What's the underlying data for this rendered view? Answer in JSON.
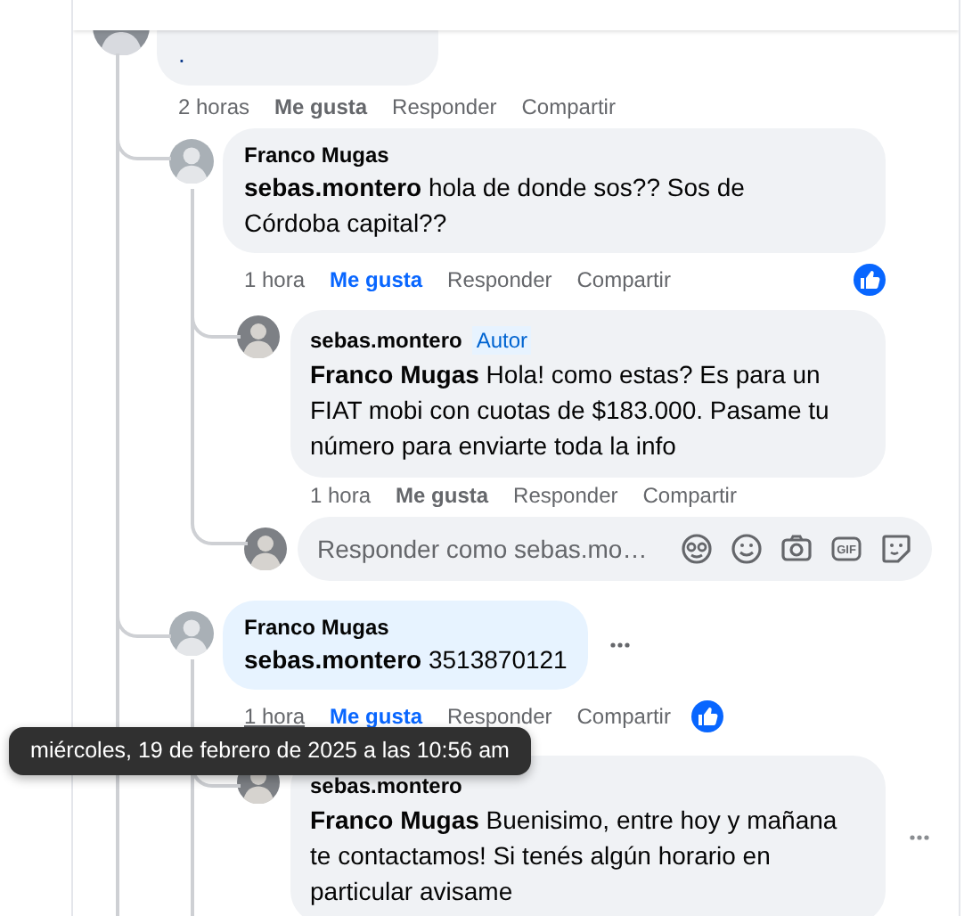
{
  "comment": {
    "body": ".",
    "time": "2 horas",
    "like": "Me gusta",
    "reply": "Responder",
    "share": "Compartir",
    "liked": false
  },
  "replies": [
    {
      "author": "Franco Mugas",
      "body": "**sebas.montero** hola de donde sos?? Sos de Córdoba capital??",
      "highlighted": false,
      "time": "1 hora",
      "time_hovered": false,
      "like": "Me gusta",
      "reply": "Responder",
      "share": "Compartir",
      "liked": true,
      "has_reaction": true,
      "replies": [
        {
          "author": "sebas.montero",
          "badge": "Autor",
          "body": "**Franco Mugas** Hola! como estas? Es para un FIAT mobi con cuotas de $183.000. Pasame tu número para enviarte toda la info",
          "time": "1 hora",
          "like": "Me gusta",
          "reply": "Responder",
          "share": "Compartir",
          "liked": false
        }
      ],
      "composer": {
        "placeholder": "Responder como sebas.mo…",
        "gif": "GIF"
      }
    },
    {
      "author": "Franco Mugas",
      "body": "**sebas.montero** 3513870121",
      "highlighted": true,
      "menu": true,
      "time": "1 hora",
      "time_hovered": true,
      "like": "Me gusta",
      "reply": "Responder",
      "share": "Compartir",
      "liked": true,
      "has_reaction": true,
      "replies": [
        {
          "author": "sebas.montero",
          "body": "**Franco Mugas** Buenisimo, entre hoy y mañana te contactamos! Si tenés algún horario en particular avisame",
          "menu": true
        }
      ]
    }
  ],
  "tooltip": "miércoles, 19 de febrero de 2025 a las 10:56 am"
}
